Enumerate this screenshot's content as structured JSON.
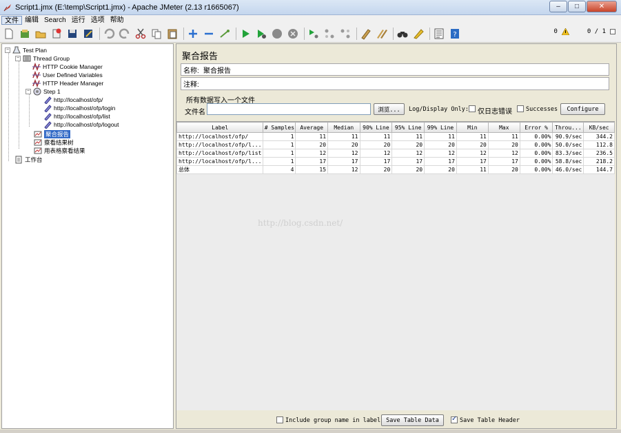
{
  "window": {
    "title": "Script1.jmx (E:\\temp\\Script1.jmx) - Apache JMeter (2.13 r1665067)",
    "controls": [
      "–",
      "□",
      "✕"
    ]
  },
  "menu": {
    "items": [
      "文件",
      "编辑",
      "Search",
      "运行",
      "选项",
      "帮助"
    ]
  },
  "toolbar": {
    "warning_count": "0",
    "thread_count": "0 / 1"
  },
  "tree": {
    "test_plan": "Test Plan",
    "thread_group": "Thread Group",
    "cookie_manager": "HTTP Cookie Manager",
    "user_defined": "User Defined Variables",
    "header_manager": "HTTP Header Manager",
    "step1": "Step 1",
    "samplers": [
      "http://localhost/ofp/",
      "http://localhost/ofp/login",
      "http://localhost/ofp/list",
      "http://localhost/ofp/logout"
    ],
    "listeners": [
      "聚合报告",
      "察看结果树",
      "用表格察看结果"
    ],
    "workbench": "工作台"
  },
  "panel": {
    "title": "聚合报告",
    "name_label": "名称:",
    "name_value": "聚合报告",
    "comment_label": "注释:",
    "comment_value": "",
    "write_all_label": "所有数据写入一个文件",
    "filename_label": "文件名",
    "filename_value": "",
    "browse_button": "浏览...",
    "log_display_label": "Log/Display Only:",
    "errors_only_label": "仅日志错误",
    "successes_label": "Successes",
    "configure_button": "Configure"
  },
  "table": {
    "headers": [
      "Label",
      "# Samples",
      "Average",
      "Median",
      "90% Line",
      "95% Line",
      "99% Line",
      "Min",
      "Max",
      "Error %",
      "Throu...",
      "KB/sec"
    ],
    "rows": [
      [
        "http://localhost/ofp/",
        "1",
        "11",
        "11",
        "11",
        "11",
        "11",
        "11",
        "11",
        "0.00%",
        "90.9/sec",
        "344.2"
      ],
      [
        "http://localhost/ofp/l...",
        "1",
        "20",
        "20",
        "20",
        "20",
        "20",
        "20",
        "20",
        "0.00%",
        "50.0/sec",
        "112.8"
      ],
      [
        "http://localhost/ofp/list",
        "1",
        "12",
        "12",
        "12",
        "12",
        "12",
        "12",
        "12",
        "0.00%",
        "83.3/sec",
        "236.5"
      ],
      [
        "http://localhost/ofp/l...",
        "1",
        "17",
        "17",
        "17",
        "17",
        "17",
        "17",
        "17",
        "0.00%",
        "58.8/sec",
        "218.2"
      ],
      [
        "总体",
        "4",
        "15",
        "12",
        "20",
        "20",
        "20",
        "11",
        "20",
        "0.00%",
        "46.0/sec",
        "144.7"
      ]
    ]
  },
  "watermark": "http://blog.csdn.net/",
  "bottom": {
    "include_group_label": "Include group name in label?",
    "save_table_button": "Save Table Data",
    "save_header_label": "Save Table Header"
  }
}
